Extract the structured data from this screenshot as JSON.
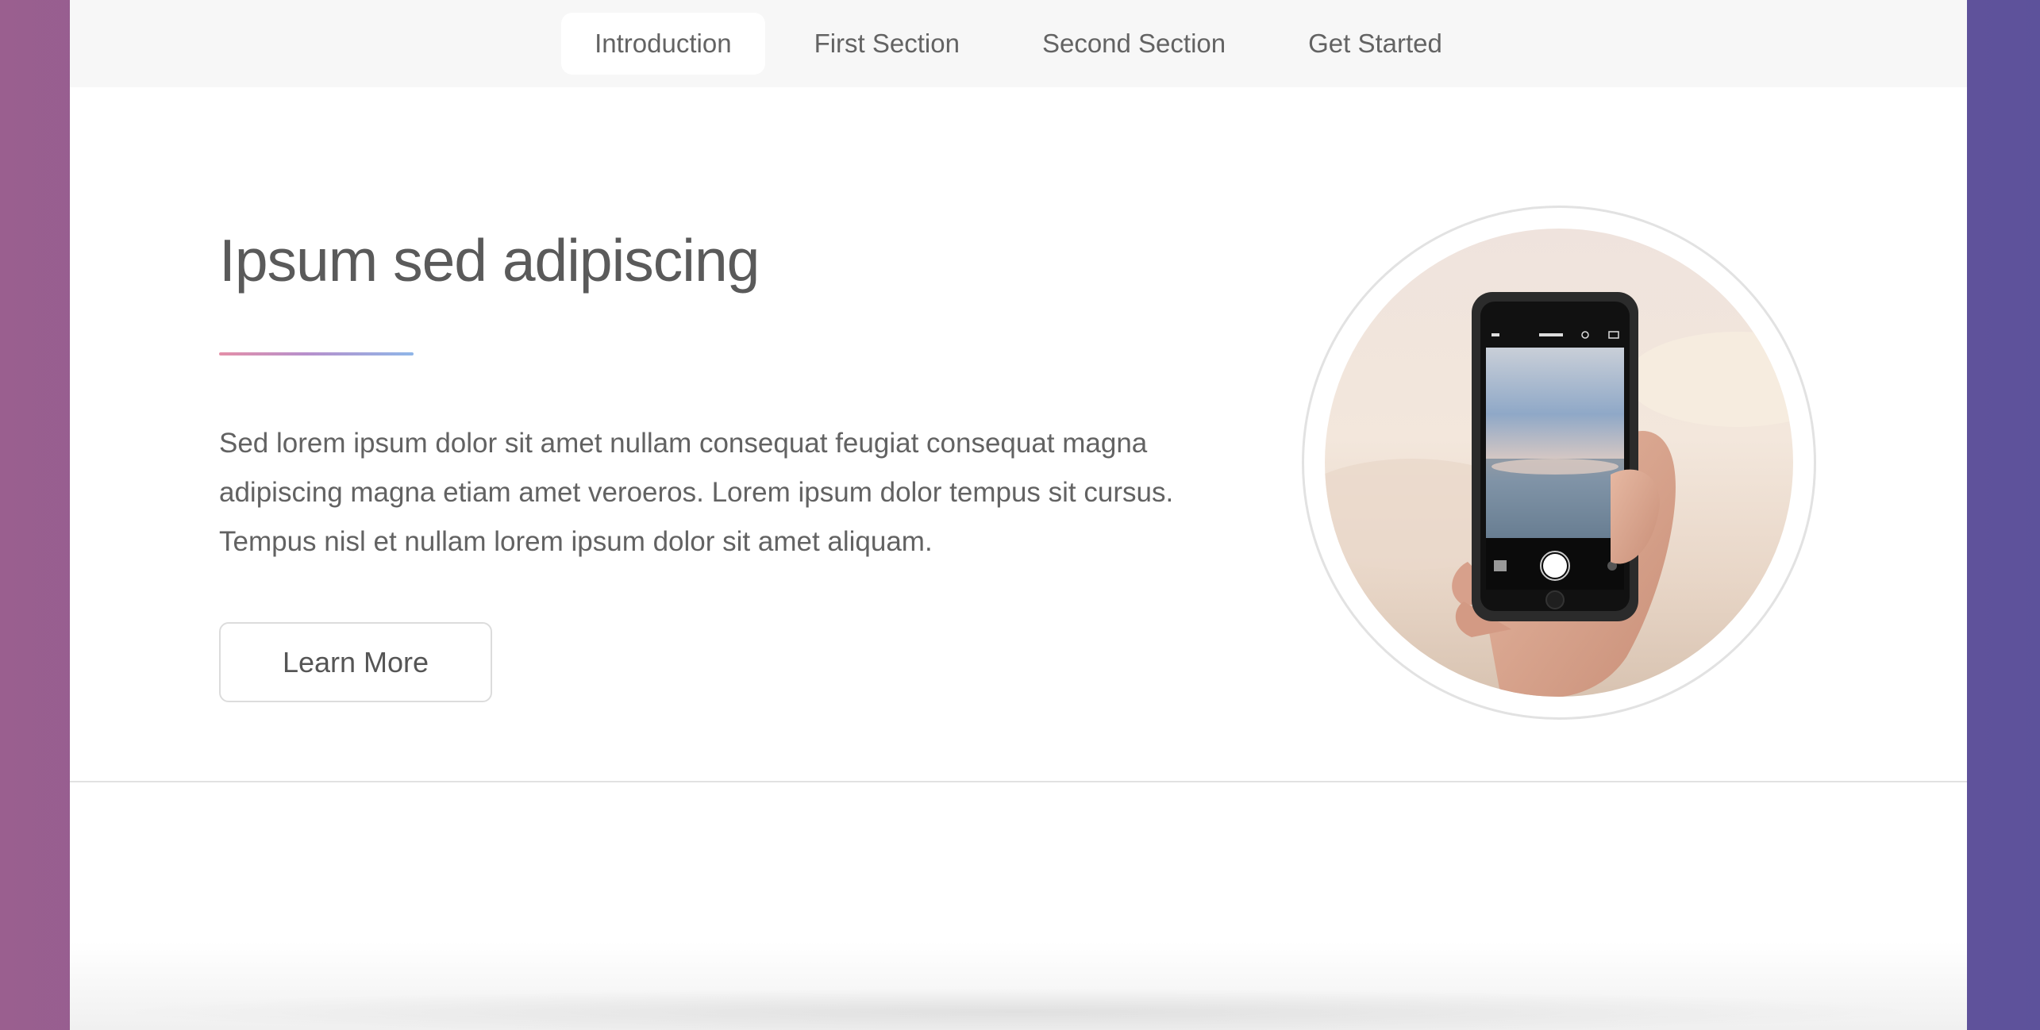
{
  "nav": {
    "items": [
      {
        "label": "Introduction",
        "active": true
      },
      {
        "label": "First Section",
        "active": false
      },
      {
        "label": "Second Section",
        "active": false
      },
      {
        "label": "Get Started",
        "active": false
      }
    ]
  },
  "intro": {
    "title": "Ipsum sed adipiscing",
    "body": "Sed lorem ipsum dolor sit amet nullam consequat feugiat consequat magna adipiscing magna etiam amet veroeros. Lorem ipsum dolor tempus sit cursus. Tempus nisl et nullam lorem ipsum dolor sit amet aliquam.",
    "button_label": "Learn More"
  },
  "colors": {
    "background_left": "#9a5f8f",
    "background_right": "#5d529b",
    "accent_gradient_start": "#e48fa8",
    "accent_gradient_end": "#8fb6e8"
  },
  "image": {
    "icon": "photo-phone-beach-icon"
  }
}
